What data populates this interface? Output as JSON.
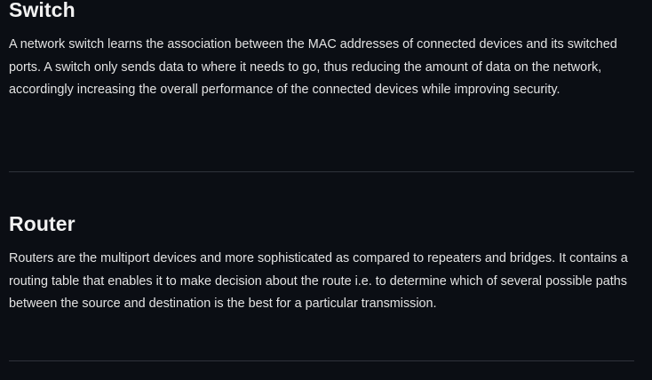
{
  "sections": [
    {
      "title": "Switch",
      "body": "A network switch learns the association between the MAC addresses of connected devices and its switched ports. A switch only sends data to where it needs to go, thus reducing the amount of data on the network, accordingly increasing the overall performance of the connected devices while improving security."
    },
    {
      "title": "Router",
      "body": "Routers are the multiport devices and more sophisticated as compared to repeaters and bridges. It contains a routing table that enables it to make decision about the route i.e. to determine which of several possible paths between the source and destination is the best for a particular transmission."
    }
  ]
}
